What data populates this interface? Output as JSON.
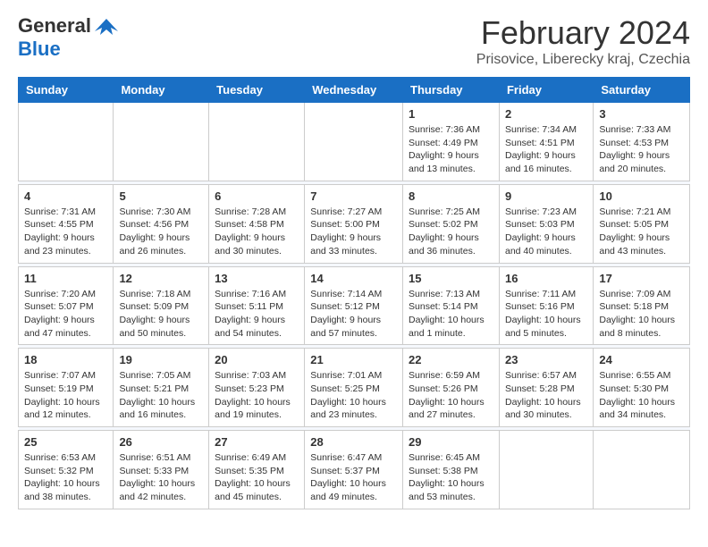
{
  "header": {
    "logo_general": "General",
    "logo_blue": "Blue",
    "month_title": "February 2024",
    "location": "Prisovice, Liberecky kraj, Czechia"
  },
  "days_of_week": [
    "Sunday",
    "Monday",
    "Tuesday",
    "Wednesday",
    "Thursday",
    "Friday",
    "Saturday"
  ],
  "weeks": [
    [
      {
        "day": "",
        "info": ""
      },
      {
        "day": "",
        "info": ""
      },
      {
        "day": "",
        "info": ""
      },
      {
        "day": "",
        "info": ""
      },
      {
        "day": "1",
        "info": "Sunrise: 7:36 AM\nSunset: 4:49 PM\nDaylight: 9 hours\nand 13 minutes."
      },
      {
        "day": "2",
        "info": "Sunrise: 7:34 AM\nSunset: 4:51 PM\nDaylight: 9 hours\nand 16 minutes."
      },
      {
        "day": "3",
        "info": "Sunrise: 7:33 AM\nSunset: 4:53 PM\nDaylight: 9 hours\nand 20 minutes."
      }
    ],
    [
      {
        "day": "4",
        "info": "Sunrise: 7:31 AM\nSunset: 4:55 PM\nDaylight: 9 hours\nand 23 minutes."
      },
      {
        "day": "5",
        "info": "Sunrise: 7:30 AM\nSunset: 4:56 PM\nDaylight: 9 hours\nand 26 minutes."
      },
      {
        "day": "6",
        "info": "Sunrise: 7:28 AM\nSunset: 4:58 PM\nDaylight: 9 hours\nand 30 minutes."
      },
      {
        "day": "7",
        "info": "Sunrise: 7:27 AM\nSunset: 5:00 PM\nDaylight: 9 hours\nand 33 minutes."
      },
      {
        "day": "8",
        "info": "Sunrise: 7:25 AM\nSunset: 5:02 PM\nDaylight: 9 hours\nand 36 minutes."
      },
      {
        "day": "9",
        "info": "Sunrise: 7:23 AM\nSunset: 5:03 PM\nDaylight: 9 hours\nand 40 minutes."
      },
      {
        "day": "10",
        "info": "Sunrise: 7:21 AM\nSunset: 5:05 PM\nDaylight: 9 hours\nand 43 minutes."
      }
    ],
    [
      {
        "day": "11",
        "info": "Sunrise: 7:20 AM\nSunset: 5:07 PM\nDaylight: 9 hours\nand 47 minutes."
      },
      {
        "day": "12",
        "info": "Sunrise: 7:18 AM\nSunset: 5:09 PM\nDaylight: 9 hours\nand 50 minutes."
      },
      {
        "day": "13",
        "info": "Sunrise: 7:16 AM\nSunset: 5:11 PM\nDaylight: 9 hours\nand 54 minutes."
      },
      {
        "day": "14",
        "info": "Sunrise: 7:14 AM\nSunset: 5:12 PM\nDaylight: 9 hours\nand 57 minutes."
      },
      {
        "day": "15",
        "info": "Sunrise: 7:13 AM\nSunset: 5:14 PM\nDaylight: 10 hours\nand 1 minute."
      },
      {
        "day": "16",
        "info": "Sunrise: 7:11 AM\nSunset: 5:16 PM\nDaylight: 10 hours\nand 5 minutes."
      },
      {
        "day": "17",
        "info": "Sunrise: 7:09 AM\nSunset: 5:18 PM\nDaylight: 10 hours\nand 8 minutes."
      }
    ],
    [
      {
        "day": "18",
        "info": "Sunrise: 7:07 AM\nSunset: 5:19 PM\nDaylight: 10 hours\nand 12 minutes."
      },
      {
        "day": "19",
        "info": "Sunrise: 7:05 AM\nSunset: 5:21 PM\nDaylight: 10 hours\nand 16 minutes."
      },
      {
        "day": "20",
        "info": "Sunrise: 7:03 AM\nSunset: 5:23 PM\nDaylight: 10 hours\nand 19 minutes."
      },
      {
        "day": "21",
        "info": "Sunrise: 7:01 AM\nSunset: 5:25 PM\nDaylight: 10 hours\nand 23 minutes."
      },
      {
        "day": "22",
        "info": "Sunrise: 6:59 AM\nSunset: 5:26 PM\nDaylight: 10 hours\nand 27 minutes."
      },
      {
        "day": "23",
        "info": "Sunrise: 6:57 AM\nSunset: 5:28 PM\nDaylight: 10 hours\nand 30 minutes."
      },
      {
        "day": "24",
        "info": "Sunrise: 6:55 AM\nSunset: 5:30 PM\nDaylight: 10 hours\nand 34 minutes."
      }
    ],
    [
      {
        "day": "25",
        "info": "Sunrise: 6:53 AM\nSunset: 5:32 PM\nDaylight: 10 hours\nand 38 minutes."
      },
      {
        "day": "26",
        "info": "Sunrise: 6:51 AM\nSunset: 5:33 PM\nDaylight: 10 hours\nand 42 minutes."
      },
      {
        "day": "27",
        "info": "Sunrise: 6:49 AM\nSunset: 5:35 PM\nDaylight: 10 hours\nand 45 minutes."
      },
      {
        "day": "28",
        "info": "Sunrise: 6:47 AM\nSunset: 5:37 PM\nDaylight: 10 hours\nand 49 minutes."
      },
      {
        "day": "29",
        "info": "Sunrise: 6:45 AM\nSunset: 5:38 PM\nDaylight: 10 hours\nand 53 minutes."
      },
      {
        "day": "",
        "info": ""
      },
      {
        "day": "",
        "info": ""
      }
    ]
  ]
}
